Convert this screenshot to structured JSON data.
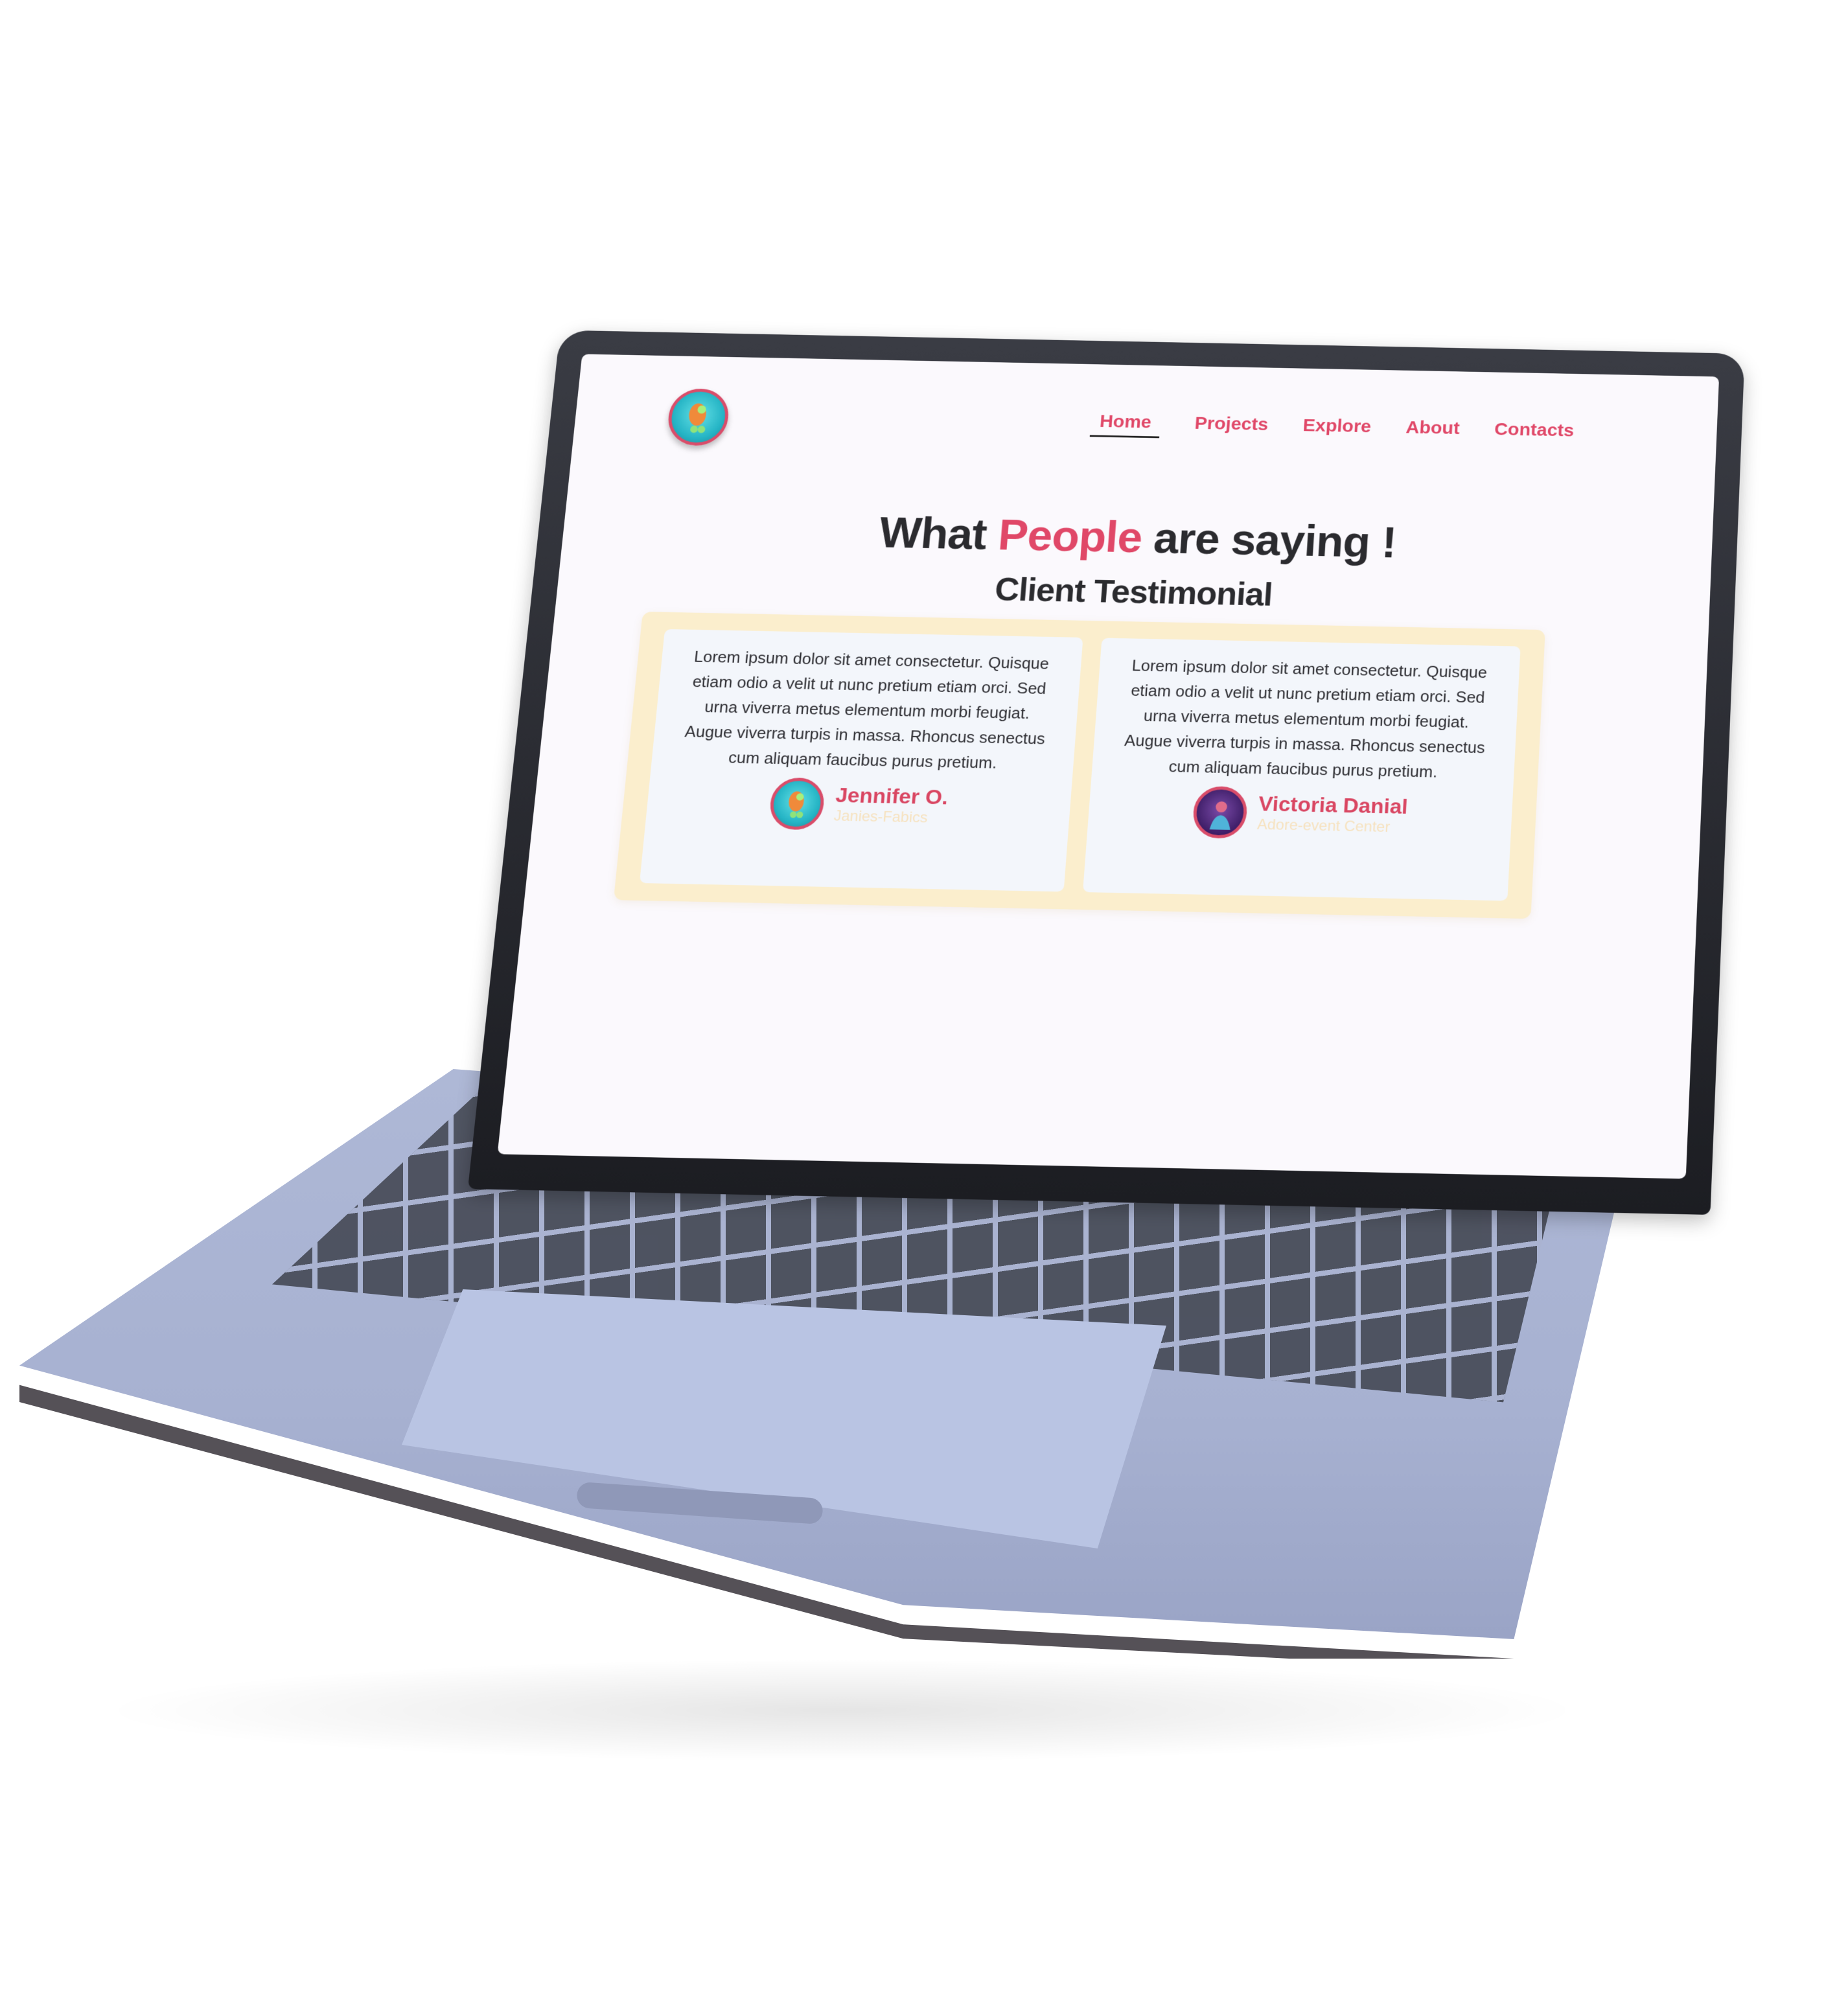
{
  "nav": {
    "items": [
      "Home",
      "Projects",
      "Explore",
      "About",
      "Contacts"
    ],
    "active": "Home"
  },
  "heading": {
    "part1": "What ",
    "accent": "People",
    "part2": " are saying !",
    "subtitle": "Client Testimonial"
  },
  "testimonials": [
    {
      "text": "Lorem ipsum dolor sit amet consectetur. Quisque etiam odio a velit ut nunc pretium etiam orci. Sed urna viverra metus elementum morbi feugiat. Augue viverra turpis in massa. Rhoncus senectus cum aliquam faucibus purus pretium.",
      "name": "Jennifer O.",
      "company": "Janies-Fabics",
      "avatar_icon": "robot-avatar-icon"
    },
    {
      "text": "Lorem ipsum dolor sit amet consectetur. Quisque etiam odio a velit ut nunc pretium etiam orci. Sed urna viverra metus elementum morbi feugiat. Augue viverra turpis in massa. Rhoncus senectus cum aliquam faucibus purus pretium.",
      "name": "Victoria Danial",
      "company": "Adore-event Center",
      "avatar_icon": "person-avatar-icon"
    }
  ],
  "colors": {
    "accent": "#e04868",
    "card_frame": "#fbeecd",
    "card_bg": "#f3f6fb",
    "heading": "#2b2b2f"
  }
}
